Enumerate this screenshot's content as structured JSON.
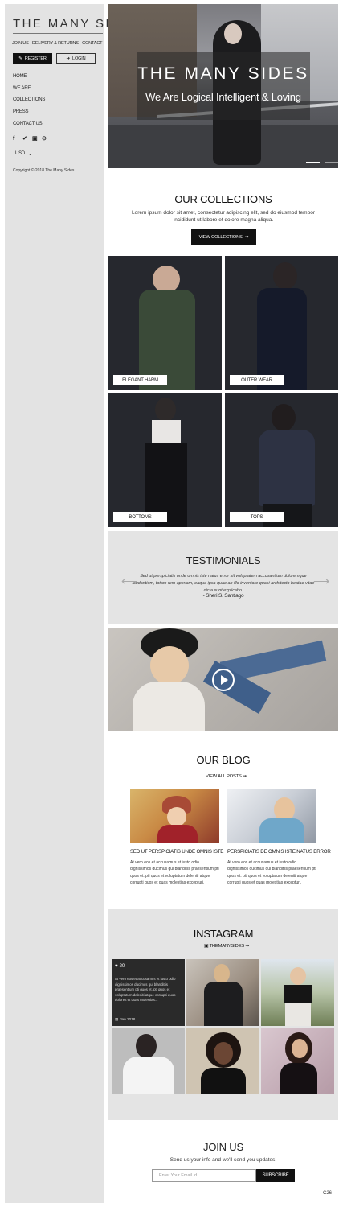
{
  "sidebar": {
    "logo": "THE MANY SIDES",
    "toplinks": "JOIN US - DELIVERY & RETURNS - CONTACT",
    "register_label": "REGISTER",
    "login_label": "LOGIN",
    "nav": [
      "HOME",
      "WE ARE",
      "COLLECTIONS",
      "PRESS",
      "CONTACT US"
    ],
    "social_icons": [
      "facebook-icon",
      "twitter-icon",
      "instagram-icon",
      "pinterest-icon"
    ],
    "currency": "USD",
    "copyright": "Copyright © 2018 The Many Sides."
  },
  "hero": {
    "title": "THE MANY SIDES",
    "subtitle": "We Are Logical Intelligent & Loving"
  },
  "collections": {
    "title": "OUR COLLECTIONS",
    "text": "Lorem ipsum dolor sit amet, consectetur adipiscing elit, sed do eiusmod tempor incididunt ut labore et dolore magna aliqua.",
    "button": "VIEW COLLECTIONS",
    "items": [
      "ELEGANT HARM",
      "OUTER WEAR",
      "BOTTOMS",
      "TOPS"
    ]
  },
  "testimonials": {
    "title": "TESTIMONIALS",
    "text": "Sed ut perspiciatis unde omnis iste natus error sit voluptatem accusantium doloremque laudantium, totam rem aperiam, eaque ipsa quae ab illo inventore quasi architecto beatae vitae dicta sunt explicabo.",
    "author": "- Sheri S. Santiago"
  },
  "blog": {
    "title": "OUR BLOG",
    "view_all": "VIEW ALL POSTS",
    "posts": [
      {
        "title": "SED UT PERSPICIATIS UNDE OMNIS ISTE",
        "excerpt": "At vero eos et accusamus et iusto odio dignissimos ducimus qui blanditiis praesentium pti quos et. pti quos et voluptatum deleniti atque corrupti quos et quas molestias excepturi."
      },
      {
        "title": "PERSPICIATIS DE OMNIS ISTE NATUS ERROR",
        "excerpt": "At vero eos et accusamus et iusto odio dignissimos ducimus qui blanditiis praesentium pti quos et. pti quos et voluptatum deleniti atque corrupti quos et quas molestias excepturi."
      }
    ]
  },
  "instagram": {
    "title": "INSTAGRAM",
    "handle": "THEMANYSIDES",
    "likes": "20",
    "caption": "At vero eos et accusamus et iusto odio dignissimos ducimus qui blanditiis praesentium pti quos et. pti quos et voluptatum deleniti atque corrupti quos dolores et quas molestias...",
    "date": "Jan 2018"
  },
  "join": {
    "title": "JOIN US",
    "subtitle": "Send us your info and we'll send you updates!",
    "email_placeholder": "Enter Your Email Id",
    "button": "SUBSCRIBE"
  },
  "corner_code": "C26"
}
